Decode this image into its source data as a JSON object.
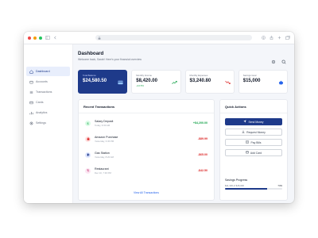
{
  "browser": {
    "url": ""
  },
  "sidebar": {
    "items": [
      {
        "label": "Dashboard",
        "icon": "home-icon",
        "active": true
      },
      {
        "label": "Accounts",
        "icon": "wallet-icon"
      },
      {
        "label": "Transactions",
        "icon": "list-icon"
      },
      {
        "label": "Cards",
        "icon": "card-icon"
      },
      {
        "label": "Analytics",
        "icon": "chart-icon"
      },
      {
        "label": "Settings",
        "icon": "gear-icon"
      }
    ]
  },
  "header": {
    "title": "Dashboard",
    "subtitle": "Welcome back, Sarah! Here's your financial overview"
  },
  "stats": [
    {
      "label": "Total Balance",
      "value": "$24,580.50",
      "change": "",
      "icon": "card-icon"
    },
    {
      "label": "Monthly Income",
      "value": "$8,420.00",
      "change": "+12.5%",
      "icon": "trend-up-icon"
    },
    {
      "label": "Monthly Expenses",
      "value": "$3,240.80",
      "change": "",
      "icon": "trend-down-icon"
    },
    {
      "label": "Savings Goal",
      "value": "$15,000",
      "change": "",
      "icon": "piggy-icon"
    }
  ],
  "transactions": {
    "title": "Recent Transactions",
    "items": [
      {
        "name": "Salary Deposit",
        "date": "Today, 9:30 AM",
        "amount": "+$4,200.00",
        "type": "credit",
        "icon": "dollar-icon"
      },
      {
        "name": "Amazon Purchase",
        "date": "Yesterday, 3:45 PM",
        "amount": "-$89.99",
        "type": "debit",
        "icon": "bag-icon"
      },
      {
        "name": "Gas Station",
        "date": "Yesterday, 8:20 AM",
        "amount": "-$65.00",
        "type": "debit",
        "icon": "fuel-icon"
      },
      {
        "name": "Restaurant",
        "date": "Dec 10, 7:30 PM",
        "amount": "-$42.50",
        "type": "debit",
        "icon": "fork-icon"
      }
    ],
    "view_all": "View All Transactions"
  },
  "quick_actions": {
    "title": "Quick Actions",
    "buttons": [
      {
        "label": "Send Money",
        "icon": "send-icon",
        "primary": true
      },
      {
        "label": "Request Money",
        "icon": "download-icon"
      },
      {
        "label": "Pay Bills",
        "icon": "receipt-icon"
      },
      {
        "label": "Add Card",
        "icon": "card-icon"
      }
    ]
  },
  "savings": {
    "title": "Savings Progress",
    "detail": "$11,100 of $15,000",
    "percent": "74%",
    "progress": 0.74
  },
  "colors": {
    "primary": "#1e3a8a",
    "credit": "#16a34a",
    "debit": "#dc2626",
    "link": "#2563eb"
  }
}
